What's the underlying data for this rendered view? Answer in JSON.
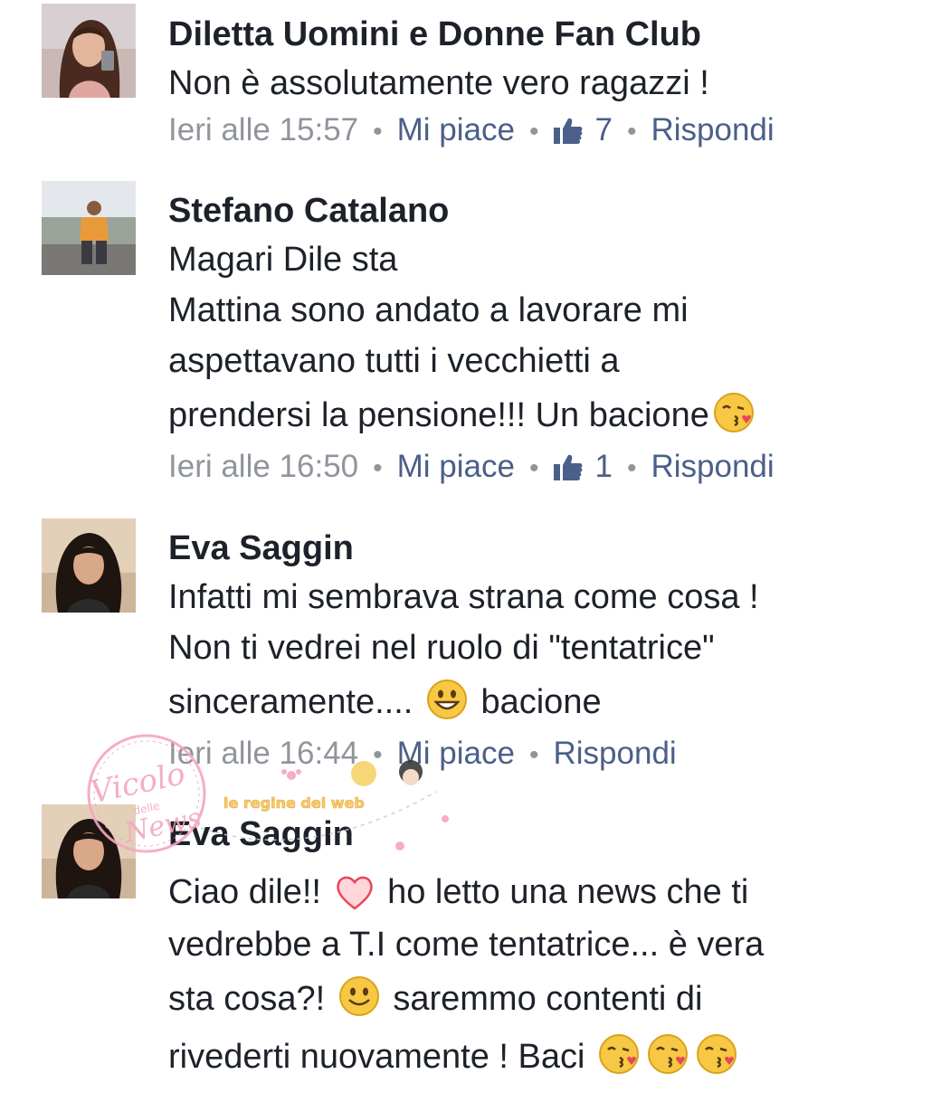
{
  "comments": [
    {
      "author": "Diletta Uomini e Donne Fan Club",
      "lines": [
        "Non è assolutamente vero ragazzi !"
      ],
      "time": "Ieri alle 15:57",
      "like_label": "Mi piace",
      "like_count": "7",
      "reply_label": "Rispondi"
    },
    {
      "author": "Stefano Catalano",
      "lines": [
        "Magari Dile sta",
        "Mattina sono andato a lavorare mi",
        "aspettavano tutti i vecchietti a",
        "prendersi la pensione!!! Un bacione"
      ],
      "time": "Ieri alle 16:50",
      "like_label": "Mi piace",
      "like_count": "1",
      "reply_label": "Rispondi"
    },
    {
      "author": "Eva Saggin",
      "lines": [
        "Infatti mi sembrava strana come cosa !",
        "Non ti vedrei nel ruolo di \"tentatrice\"",
        "sinceramente....",
        "bacione"
      ],
      "time": "Ieri alle 16:44",
      "like_label": "Mi piace",
      "reply_label": "Rispondi"
    },
    {
      "author": "Eva Saggin",
      "lines": [
        "Ciao dile!!",
        "ho letto una news che ti",
        "vedrebbe a T.I come tentatrice... è vera",
        "sta cosa?!",
        "saremmo contenti di",
        "rivederti nuovamente ! Baci"
      ]
    }
  ],
  "watermark": {
    "brand": "Vicolo delle News",
    "tagline": "le regine del web"
  },
  "colors": {
    "text": "#1d2129",
    "meta_grey": "#90949c",
    "link_blue": "#4b5f88",
    "watermark_pink": "#f4a6c0"
  },
  "icons": [
    "like-thumb-icon",
    "kiss-emoji-icon",
    "grin-emoji-icon",
    "smile-emoji-icon",
    "heart-icon"
  ]
}
